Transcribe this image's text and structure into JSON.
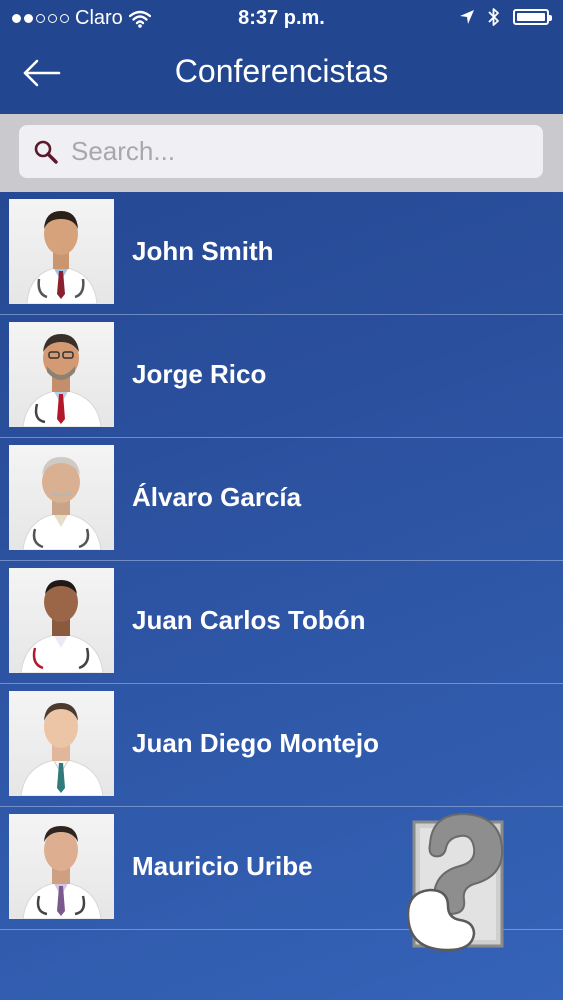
{
  "status": {
    "carrier": "Claro",
    "time": "8:37 p.m."
  },
  "nav": {
    "title": "Conferencistas"
  },
  "search": {
    "placeholder": "Search..."
  },
  "speakers": [
    {
      "name": "John Smith"
    },
    {
      "name": "Jorge Rico"
    },
    {
      "name": "Álvaro García"
    },
    {
      "name": "Juan Carlos Tobón"
    },
    {
      "name": "Juan Diego Montejo"
    },
    {
      "name": "Mauricio Uribe"
    }
  ],
  "icons": {
    "back": "back-arrow-icon",
    "search": "search-icon",
    "wifi": "wifi-icon",
    "location": "location-arrow-icon",
    "bluetooth": "bluetooth-icon",
    "battery": "battery-icon"
  },
  "colors": {
    "nav_bg": "#22468f",
    "list_bg": "#2a4f9c",
    "search_bar_bg": "#c9c9ce"
  }
}
